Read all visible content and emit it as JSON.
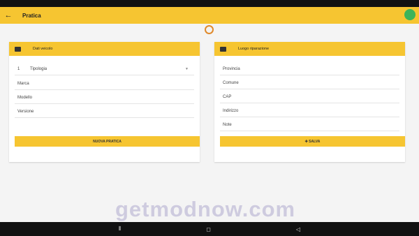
{
  "app": {
    "title": "Pratica",
    "back_icon": "arrow-left-icon",
    "fab_color": "#3cb45a",
    "accent": "#f6c531"
  },
  "left_panel": {
    "title": "Dati veicolo",
    "icon": "car-icon",
    "select": {
      "number": "1",
      "label": "Tipologia"
    },
    "fields": [
      "Marca",
      "Modello",
      "Versione"
    ],
    "button_label": "NUOVA PRATICA"
  },
  "right_panel": {
    "title": "Luogo riparazione",
    "icon": "book-icon",
    "fields": [
      "Provincia",
      "Comune",
      "CAP",
      "Indirizzo",
      "Note"
    ],
    "button_label": "✚ SALVA"
  },
  "watermark": "getmodnow.com",
  "nav": {
    "back": "◁",
    "home": "◻",
    "recents": "⫴"
  }
}
